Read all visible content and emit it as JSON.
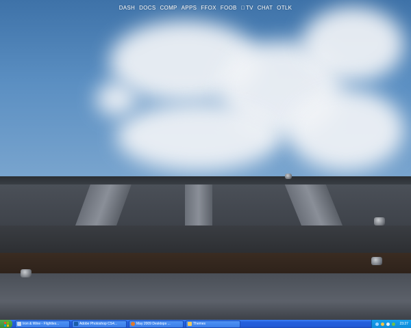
{
  "dock": {
    "items": [
      {
        "label": "DASH"
      },
      {
        "label": "DOCS"
      },
      {
        "label": "COMP"
      },
      {
        "label": "APPS"
      },
      {
        "label": "FFOX"
      },
      {
        "label": "FOOB"
      },
      {
        "label": "",
        "icon": "apple-icon"
      },
      {
        "label": "TV"
      },
      {
        "label": "CHAT"
      },
      {
        "label": "OTLK"
      }
    ]
  },
  "taskbar": {
    "start_icon": "windows-flag-icon",
    "buttons": [
      {
        "label": "Iron & Wine - Flightles...",
        "icon": "media-player-icon",
        "color": "#c9d8ef"
      },
      {
        "label": "Adobe Photoshop CS4...",
        "icon": "photoshop-icon",
        "color": "#1b5da8"
      },
      {
        "label": "May 2009 Desktops ...",
        "icon": "firefox-icon",
        "color": "#e0792b"
      },
      {
        "label": "Themes",
        "icon": "folder-icon",
        "color": "#f0c75a"
      }
    ],
    "tray": {
      "icons": [
        "network-icon",
        "security-icon",
        "volume-icon",
        "messenger-icon"
      ],
      "clock": "23:27"
    }
  },
  "colors": {
    "taskbar_blue": "#245edc",
    "start_green": "#3a8d35",
    "tray_blue": "#0f8ad9"
  }
}
